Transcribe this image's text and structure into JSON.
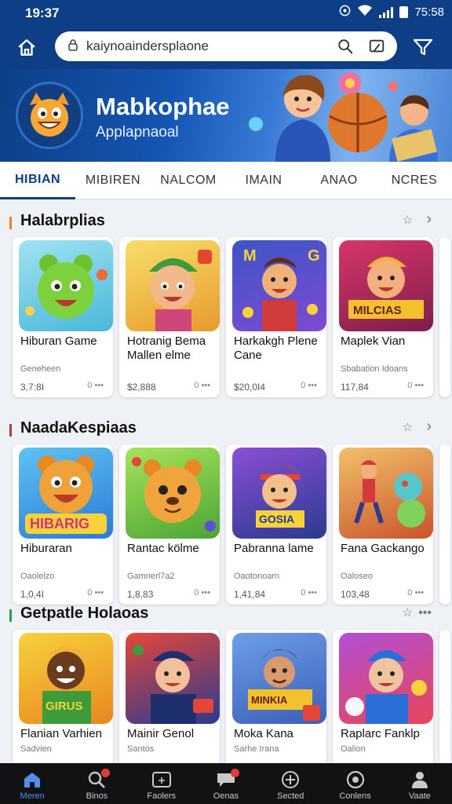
{
  "status_bar": {
    "time": "19:37",
    "battery_text": "75:58"
  },
  "search": {
    "value": "kaiynoaindersplaone"
  },
  "banner": {
    "title": "Mabkophae",
    "subtitle": "Applapnaoal"
  },
  "tabs": [
    "HIBIAN",
    "MIBIREN",
    "NALCOM",
    "IMAIN",
    "ANAO",
    "NCRES"
  ],
  "sections": [
    {
      "title": "Halabrplias",
      "accent": "#f07b2a",
      "cards": [
        {
          "name": "Hiburan Game",
          "dev": "Geneheen",
          "meta": "3,7:8I",
          "dots": "0 •••",
          "thumb": "#7bd6e8",
          "face": "#7dd13c"
        },
        {
          "name": "Hotranig Bema Mallen elme",
          "dev": "",
          "meta": "$2,888",
          "dots": "0 •••",
          "thumb": "#f1c64c",
          "face": "#f3b88a"
        },
        {
          "name": "Harkakgh Plene Cane",
          "dev": "",
          "meta": "$20,0I4",
          "dots": "0 •••",
          "thumb": "#4f6cd1",
          "face": "#f0b27a"
        },
        {
          "name": "Maplek Vian",
          "dev": "Sbabation Idoans",
          "meta": "117,84",
          "dots": "0 •••",
          "thumb": "#c72a5c",
          "face": "#f2b07e"
        }
      ]
    },
    {
      "title": "NaadaKespiaas",
      "accent": "#c0392b",
      "cards": [
        {
          "name": "Hiburaran",
          "dev": "Oaolelzo",
          "meta": "1,0,4I",
          "dots": "0 •••",
          "thumb": "#3aa6e8",
          "face": "#f0a23a"
        },
        {
          "name": "Rantac kölme",
          "dev": "Gamnerl7a2",
          "meta": "1,8,83",
          "dots": "0 •••",
          "thumb": "#8bd34a",
          "face": "#f2a43c"
        },
        {
          "name": "Pabranna lame",
          "dev": "Oaotonoarn",
          "meta": "1,41,84",
          "dots": "0 •••",
          "thumb": "#6a3fb8",
          "face": "#f3c08c"
        },
        {
          "name": "Fana Gackango",
          "dev": "Oaloseo",
          "meta": "103,48",
          "dots": "0 •••",
          "thumb": "#e8a040",
          "face": "#58c6c8"
        }
      ]
    },
    {
      "title": "Getpatle Holaoas",
      "accent": "#2ea04a",
      "cards": [
        {
          "name": "Flanian Varhien",
          "dev": "Sadvien",
          "meta": "",
          "dots": "",
          "thumb": "#f0c31a",
          "face": "#6b3b1e"
        },
        {
          "name": "Mainir Genol",
          "dev": "Santos",
          "meta": "",
          "dots": "",
          "thumb": "#2a3b8f",
          "face": "#f2c09a"
        },
        {
          "name": "Moka Kana",
          "dev": "Sarhe Irana",
          "meta": "",
          "dots": "",
          "thumb": "#4a78c9",
          "face": "#d99a6c"
        },
        {
          "name": "Raplarc Fanklp",
          "dev": "Oalion",
          "meta": "",
          "dots": "",
          "thumb": "#8a3fd0",
          "face": "#f0c4a0"
        }
      ]
    }
  ],
  "bottom_nav": [
    {
      "label": "Meren",
      "icon": "home-icon",
      "active": true
    },
    {
      "label": "Binos",
      "icon": "search-icon",
      "badge": true
    },
    {
      "label": "Faolers",
      "icon": "frame-icon"
    },
    {
      "label": "Oenas",
      "icon": "chat-icon",
      "badge": true
    },
    {
      "label": "Sected",
      "icon": "gamepad-icon"
    },
    {
      "label": "Conlens",
      "icon": "clock-icon"
    },
    {
      "label": "Vaate",
      "icon": "person-icon"
    }
  ],
  "colors": {
    "primary": "#0e3f86",
    "nav_bg": "#111214",
    "nav_active": "#4d8ff0"
  }
}
